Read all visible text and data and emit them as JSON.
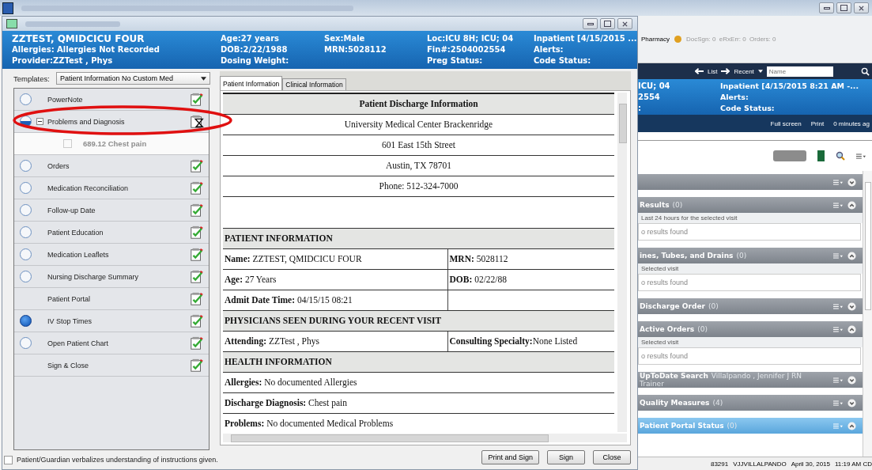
{
  "app_window": {
    "toolbar": {
      "pharmacy": "Pharmacy",
      "counters": "DocSgn: 0  eRxErr: 0  Orders: 0"
    },
    "nav": {
      "list": "List",
      "recent": "Recent",
      "name_placeholder": "Name"
    },
    "banner": [
      [
        "ICU; 04",
        "2554",
        ":"
      ],
      [
        "Inpatient [4/15/2015 8:21 AM -...",
        "Alerts:",
        "Code Status:"
      ]
    ],
    "actions": [
      "Full screen",
      "Print",
      "0 minutes ag"
    ],
    "sections": [
      {
        "expanded": false,
        "selected": false
      },
      {
        "title": "Results",
        "count": "(0)",
        "expanded": true,
        "selected": false,
        "subtitle": "Last 24 hours for the selected visit",
        "body": "o results found"
      },
      {
        "title": "ines, Tubes, and Drains",
        "count": "(0)",
        "expanded": true,
        "selected": false,
        "subtitle": "Selected visit",
        "body": "o results found"
      },
      {
        "title": "Discharge Order",
        "count": "(0)",
        "expanded": false,
        "selected": false
      },
      {
        "title": "Active Orders",
        "count": "(0)",
        "expanded": true,
        "selected": false,
        "subtitle": "Selected visit",
        "body": "o results found"
      },
      {
        "title": "UpToDate Search",
        "detail": "Villalpando , Jennifer J RN",
        "detail_2": "Trainer",
        "expanded": false,
        "selected": false
      },
      {
        "title": "Quality Measures",
        "count": "(4)",
        "expanded": false,
        "selected": false
      },
      {
        "title": "Patient Portal Status",
        "count": "(0)",
        "expanded": true,
        "selected": true
      }
    ],
    "status_bar": [
      "83291",
      "VJJVILLALPANDO",
      "April 30, 2015",
      "11:19 AM CD"
    ]
  },
  "dialog": {
    "header_columns": [
      [
        "ZZTEST, QMIDCICU FOUR",
        "Allergies:  Allergies Not Recorded",
        "Provider:ZZTest , Phys"
      ],
      [
        "Age:27 years",
        "DOB:2/22/1988",
        "Dosing Weight:"
      ],
      [
        "Sex:Male",
        "MRN:5028112"
      ],
      [
        "Loc:ICU 8H; ICU; 04",
        "Fin#:2504002554",
        "Preg Status:"
      ],
      [
        "Inpatient [4/15/2015 ...",
        "Alerts:",
        "Code Status:"
      ]
    ],
    "templates_label": "Templates:",
    "template": "Patient Information No Custom Med",
    "steps": [
      {
        "label": "PowerNote",
        "circle": true,
        "filled": false,
        "in_progress": false
      },
      {
        "label": "Problems and Diagnosis",
        "circle": true,
        "filled": false,
        "in_progress": true,
        "expanded": true,
        "children": [
          {
            "label": "689.12 Chest pain"
          }
        ]
      },
      {
        "label": "Orders",
        "circle": true,
        "filled": false,
        "in_progress": false
      },
      {
        "label": "Medication Reconciliation",
        "circle": true,
        "filled": false,
        "in_progress": false
      },
      {
        "label": "Follow-up Date",
        "circle": true,
        "filled": false,
        "in_progress": false
      },
      {
        "label": "Patient Education",
        "circle": true,
        "filled": false,
        "in_progress": false
      },
      {
        "label": "Medication Leaflets",
        "circle": true,
        "filled": false,
        "in_progress": false
      },
      {
        "label": "Nursing Discharge Summary",
        "circle": true,
        "filled": false,
        "in_progress": false
      },
      {
        "label": "Patient Portal",
        "circle": false,
        "filled": false,
        "in_progress": false
      },
      {
        "label": "IV Stop Times",
        "circle": true,
        "filled": true,
        "in_progress": false
      },
      {
        "label": "Open Patient Chart",
        "circle": true,
        "filled": false,
        "in_progress": false
      },
      {
        "label": "Sign & Close",
        "circle": false,
        "filled": false,
        "in_progress": false
      }
    ],
    "tabs": [
      {
        "label": "Patient Information",
        "selected": true
      },
      {
        "label": "Clinical Information",
        "selected": false
      }
    ],
    "document_rows": [
      {
        "kind": "title",
        "text": "Patient Discharge Information"
      },
      {
        "kind": "center",
        "text": "University Medical Center Brackenridge"
      },
      {
        "kind": "center",
        "text": "601 East 15th Street"
      },
      {
        "kind": "center",
        "text": "Austin, TX 78701"
      },
      {
        "kind": "center",
        "text": "Phone: 512-324-7000"
      },
      {
        "kind": "blank"
      },
      {
        "kind": "section",
        "text": "PATIENT INFORMATION"
      },
      {
        "kind": "pair",
        "cells": [
          "**Name:** ZZTEST, QMIDCICU FOUR",
          "**MRN:** 5028112"
        ]
      },
      {
        "kind": "pair",
        "cells": [
          "**Age:** 27 Years",
          "**DOB:** 02/22/88"
        ]
      },
      {
        "kind": "pair",
        "cells": [
          "**Admit Date Time:** 04/15/15 08:21"
        ]
      },
      {
        "kind": "section",
        "text": "PHYSICIANS SEEN DURING YOUR RECENT VISIT"
      },
      {
        "kind": "pair",
        "cells": [
          "**Attending:** ZZTest , Phys",
          "**Consulting Specialty:**None Listed"
        ]
      },
      {
        "kind": "section",
        "text": "HEALTH INFORMATION"
      },
      {
        "kind": "full",
        "text": "**Allergies:** No documented Allergies"
      },
      {
        "kind": "full",
        "text": "**Discharge Diagnosis:** Chest pain"
      },
      {
        "kind": "full",
        "text": "**Problems:** No documented Medical Problems"
      }
    ],
    "acknowledgement": {
      "label": "Patient/Guardian verbalizes understanding of instructions given.",
      "checked": false
    },
    "buttons": [
      "Print and Sign",
      "Sign",
      "Close"
    ]
  }
}
